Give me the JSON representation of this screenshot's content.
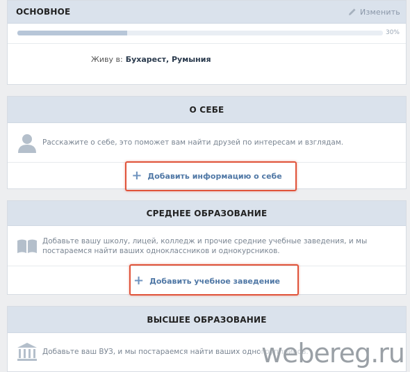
{
  "main": {
    "title": "ОСНОВНОЕ",
    "edit_label": "Изменить",
    "progress": {
      "value": 0.3,
      "label": "30%"
    },
    "live_label": "Живу в:",
    "live_value": "Бухарест, Румыния"
  },
  "about": {
    "title": "О СЕБЕ",
    "text": "Расскажите о себе, это поможет вам найти друзей по интересам и взглядам.",
    "add_label": "Добавить информацию о себе"
  },
  "school": {
    "title": "СРЕДНЕЕ ОБРАЗОВАНИЕ",
    "text_line1": "Добавьте вашу школу, лицей, колледж и прочие средние учебные заведения, и мы",
    "text_line2": "постараемся найти ваших одноклассников и однокурсников.",
    "add_label": "Добавить учебное заведение"
  },
  "university": {
    "title": "ВЫСШЕЕ ОБРАЗОВАНИЕ",
    "text": "Добавьте ваш ВУЗ, и мы постараемся найти ваших одногруппников."
  },
  "watermark": "webereg.ru",
  "colors": {
    "highlight": "#e0533a",
    "link": "#4f77a5",
    "header_bg": "#dae2ec"
  }
}
